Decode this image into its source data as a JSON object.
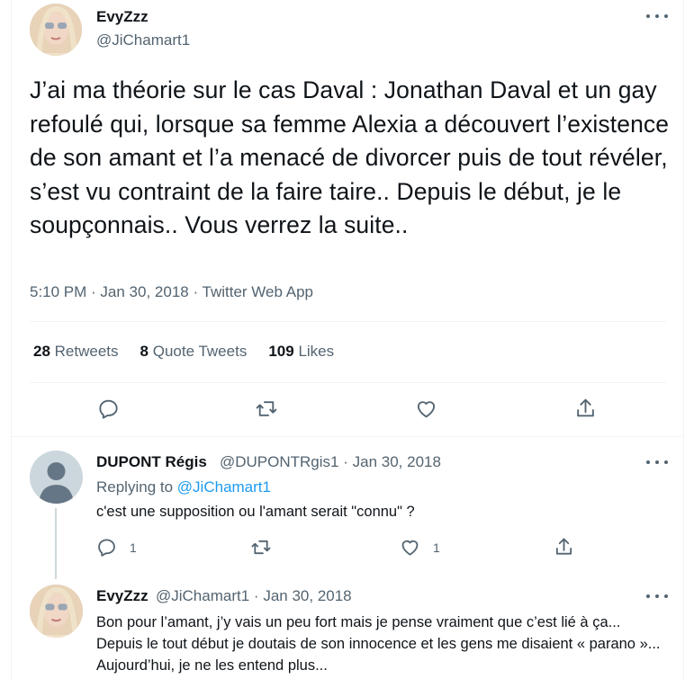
{
  "main_tweet": {
    "author_name": "EvyZzz",
    "author_handle": "@JiChamart1",
    "text": "J’ai ma théorie sur le cas Daval : Jonathan Daval et un gay refoulé qui, lorsque sa femme Alexia a découvert l’existence de son amant et l’a menacé de divorcer puis de tout révéler, s’est vu contraint de la faire taire.. Depuis le début, je le soupçonnais.. Vous verrez la suite..",
    "meta": "5:10 PM · Jan 30, 2018 · Twitter Web App",
    "stats": {
      "retweets_count": "28",
      "retweets_label": "Retweets",
      "quotes_count": "8",
      "quotes_label": "Quote Tweets",
      "likes_count": "109",
      "likes_label": "Likes"
    }
  },
  "replies": [
    {
      "author_name": "DUPONT Régis",
      "author_handle": "@DUPONTRgis1",
      "separator": "·",
      "date": "Jan 30, 2018",
      "replying_to_label": "Replying to",
      "replying_to_handle": "@JiChamart1",
      "text": "c'est une supposition ou l'amant serait \"connu\" ?",
      "reply_count": "1",
      "like_count": "1"
    },
    {
      "author_name": "EvyZzz",
      "author_handle": "@JiChamart1",
      "separator": "·",
      "date": "Jan 30, 2018",
      "text": "Bon pour l’amant, j’y vais un peu fort mais je pense vraiment que c’est lié à ça... Depuis le tout début je doutais de son innocence et les gens me disaient « parano »... Aujourd’hui, je ne les entend plus..."
    }
  ],
  "colors": {
    "accent": "#1d9bf0",
    "secondary_text": "#536471",
    "divider": "#eff3f4"
  }
}
